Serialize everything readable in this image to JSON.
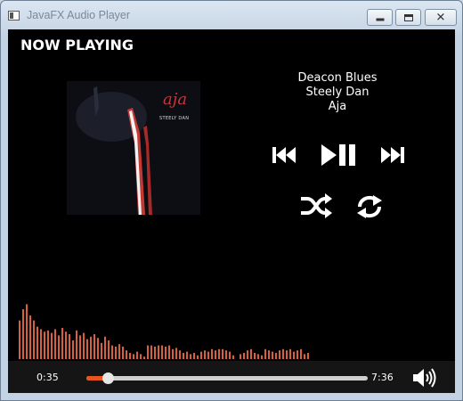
{
  "window": {
    "title": "JavaFX Audio Player",
    "controls": [
      "minimize-icon",
      "maximize-icon",
      "close-icon"
    ]
  },
  "header": {
    "label": "NOW PLAYING"
  },
  "album_art": {
    "logo_text": "aja",
    "artist_text": "STEELY DAN"
  },
  "track": {
    "title": "Deacon Blues",
    "artist": "Steely Dan",
    "album": "Aja"
  },
  "controls": {
    "buttons": [
      "previous-icon",
      "play-pause-icon",
      "next-icon",
      "shuffle-icon",
      "repeat-icon"
    ]
  },
  "spectrum": {
    "color": "#d9603c",
    "levels": [
      0.62,
      0.8,
      0.88,
      0.7,
      0.62,
      0.52,
      0.48,
      0.44,
      0.46,
      0.42,
      0.48,
      0.38,
      0.5,
      0.44,
      0.4,
      0.3,
      0.46,
      0.38,
      0.42,
      0.32,
      0.36,
      0.4,
      0.34,
      0.26,
      0.36,
      0.3,
      0.22,
      0.2,
      0.24,
      0.2,
      0.14,
      0.1,
      0.08,
      0.12,
      0.08,
      0.04,
      0.22,
      0.22,
      0.2,
      0.22,
      0.22,
      0.2,
      0.22,
      0.16,
      0.18,
      0.14,
      0.1,
      0.12,
      0.08,
      0.1,
      0.06,
      0.12,
      0.14,
      0.12,
      0.16,
      0.14,
      0.16,
      0.16,
      0.14,
      0.12,
      0.06,
      0.0,
      0.08,
      0.1,
      0.14,
      0.16,
      0.1,
      0.08,
      0.06,
      0.16,
      0.14,
      0.12,
      0.1,
      0.14,
      0.16,
      0.14,
      0.16,
      0.12,
      0.14,
      0.16,
      0.08,
      0.1
    ]
  },
  "playback": {
    "current_time": "0:35",
    "total_time": "7:36",
    "progress": 0.077,
    "accent": "#e8541e",
    "volume_icon": "volume-icon"
  }
}
